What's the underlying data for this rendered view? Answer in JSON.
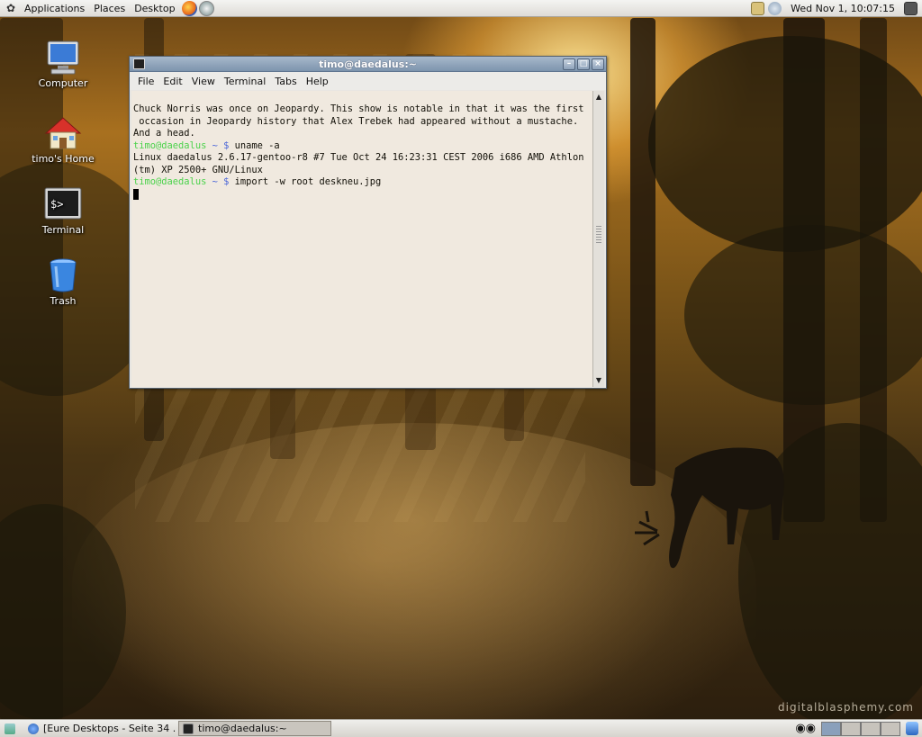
{
  "top_panel": {
    "menus": [
      "Applications",
      "Places",
      "Desktop"
    ],
    "clock": "Wed Nov  1, 10:07:15"
  },
  "desktop_icons": [
    {
      "label": "Computer",
      "icon": "computer-icon"
    },
    {
      "label": "timo's Home",
      "icon": "home-folder-icon"
    },
    {
      "label": "Terminal",
      "icon": "terminal-icon"
    },
    {
      "label": "Trash",
      "icon": "trash-icon"
    }
  ],
  "terminal": {
    "title": "timo@daedalus:~",
    "menu": [
      "File",
      "Edit",
      "View",
      "Terminal",
      "Tabs",
      "Help"
    ],
    "lines": {
      "l1": "Chuck Norris was once on Jeopardy. This show is notable in that it was the first",
      "l2": " occasion in Jeopardy history that Alex Trebek had appeared without a mustache.",
      "l3": "And a head.",
      "p1_user": "timo@daedalus",
      "p1_sym": " ~ $",
      "p1_cmd": " uname -a",
      "l5": "Linux daedalus 2.6.17-gentoo-r8 #7 Tue Oct 24 16:23:31 CEST 2006 i686 AMD Athlon",
      "l6": "(tm) XP 2500+ GNU/Linux",
      "p2_user": "timo@daedalus",
      "p2_sym": " ~ $",
      "p2_cmd": " import -w root deskneu.jpg"
    }
  },
  "taskbar": {
    "tasks": [
      {
        "label": "[Eure Desktops - Seite 34 ..."
      },
      {
        "label": "timo@daedalus:~"
      }
    ]
  },
  "watermark": "digitalblasphemy.com",
  "colors": {
    "prompt_user": "#4bd24b",
    "prompt_symbol": "#4b66d8"
  }
}
